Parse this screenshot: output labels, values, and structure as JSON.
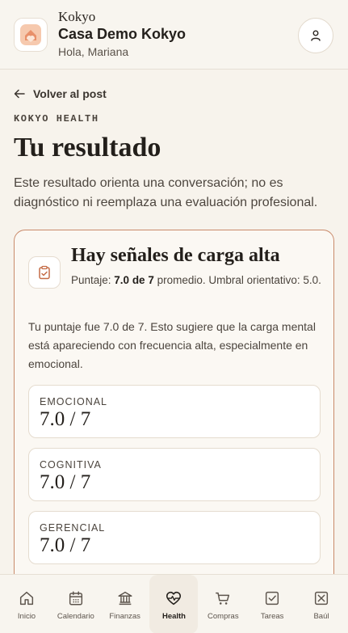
{
  "header": {
    "kicker": "Kokyo",
    "title": "Casa Demo Kokyo",
    "greeting": "Hola, Mariana"
  },
  "content": {
    "back_label": "Volver al post",
    "eyebrow": "KOKYO HEALTH",
    "title": "Tu resultado",
    "disclaimer": "Este resultado orienta una conversación; no es diagnóstico ni reemplaza una evaluación profesional."
  },
  "result": {
    "heading": "Hay señales de carga alta",
    "score_prefix": "Puntaje: ",
    "score_value": "7.0 de 7",
    "score_suffix": " promedio. Umbral orientativo: 5.0.",
    "description": "Tu puntaje fue 7.0 de 7. Esto sugiere que la carga mental está apareciendo con frecuencia alta, especialmente en emocional.",
    "dimensions": [
      {
        "label": "EMOCIONAL",
        "value": "7.0 / 7"
      },
      {
        "label": "COGNITIVA",
        "value": "7.0 / 7"
      },
      {
        "label": "GERENCIAL",
        "value": "7.0 / 7"
      }
    ]
  },
  "nav": {
    "items": [
      {
        "label": "Inicio",
        "icon": "home-icon"
      },
      {
        "label": "Calendario",
        "icon": "calendar-icon"
      },
      {
        "label": "Finanzas",
        "icon": "bank-icon"
      },
      {
        "label": "Health",
        "icon": "heart-pulse-icon",
        "active": true
      },
      {
        "label": "Compras",
        "icon": "cart-icon"
      },
      {
        "label": "Tareas",
        "icon": "checkbox-icon"
      },
      {
        "label": "Baúl",
        "icon": "box-icon"
      }
    ]
  },
  "colors": {
    "background": "#f7f3ec",
    "accent": "#c98a6a",
    "logo": "#e89a72"
  }
}
